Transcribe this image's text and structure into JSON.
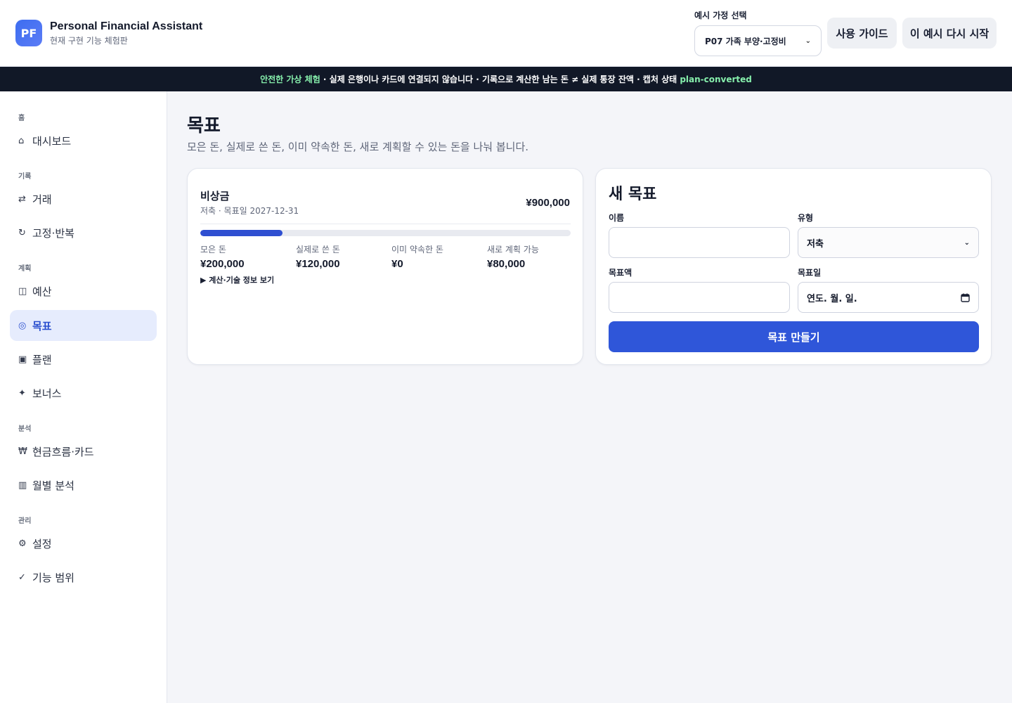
{
  "app": {
    "logo": "PF",
    "title": "Personal Financial Assistant",
    "subtitle": "현재 구현 기능 체험판"
  },
  "header": {
    "household_label": "예시 가정 선택",
    "household_value": "P07 가족 부양·고정비",
    "guide_button": "사용 가이드",
    "restart_button": "이 예시 다시 시작"
  },
  "banner": {
    "highlight": "안전한 가상 체험",
    "text": " · 실제 은행이나 카드에 연결되지 않습니다 · 기록으로 계산한 남는 돈 ≠ 실제 통장 잔액 · 캡처 상태 ",
    "state": "plan-converted"
  },
  "sidebar": {
    "groups": {
      "home": "홈",
      "records": "기록",
      "plan": "계획",
      "analysis": "분석",
      "manage": "관리"
    },
    "items": {
      "dashboard": {
        "icon": "⌂",
        "label": "대시보드"
      },
      "transactions": {
        "icon": "⇄",
        "label": "거래"
      },
      "recurring": {
        "icon": "↻",
        "label": "고정·반복"
      },
      "budget": {
        "icon": "◫",
        "label": "예산"
      },
      "goals": {
        "icon": "◎",
        "label": "목표"
      },
      "plan": {
        "icon": "▣",
        "label": "플랜"
      },
      "bonus": {
        "icon": "✦",
        "label": "보너스"
      },
      "cashflow": {
        "icon": "₩",
        "label": "현금흐름·카드"
      },
      "monthly": {
        "icon": "▥",
        "label": "월별 분석"
      },
      "settings": {
        "icon": "⚙",
        "label": "설정"
      },
      "scope": {
        "icon": "✓",
        "label": "기능 범위"
      }
    },
    "active": "goals"
  },
  "page": {
    "title": "목표",
    "description": "모은 돈, 실제로 쓴 돈, 이미 약속한 돈, 새로 계획할 수 있는 돈을 나눠 봅니다."
  },
  "goal": {
    "name": "비상금",
    "meta": "저축 · 목표일 2027-12-31",
    "target": "¥900,000",
    "progress_fraction": 0.222,
    "stats": {
      "saved": {
        "label": "모은 돈",
        "value": "¥200,000"
      },
      "spent": {
        "label": "실제로 쓴 돈",
        "value": "¥120,000"
      },
      "committed": {
        "label": "이미 약속한 돈",
        "value": "¥0"
      },
      "available": {
        "label": "새로 계획 가능",
        "value": "¥80,000"
      }
    },
    "details_toggle": "▶ 계산·기술 정보 보기"
  },
  "new_goal": {
    "title": "새 목표",
    "name_label": "이름",
    "name_value": "",
    "type_label": "유형",
    "type_value": "저축",
    "amount_label": "목표액",
    "amount_value": "",
    "date_label": "목표일",
    "date_placeholder": "연도. 월. 일.",
    "submit_label": "목표 만들기"
  },
  "colors": {
    "accent": "#2f56d9",
    "progress": "#2f4fd1",
    "banner_bg": "#111827",
    "banner_highlight": "#86efac",
    "active_nav_bg": "#e6ecfd"
  }
}
